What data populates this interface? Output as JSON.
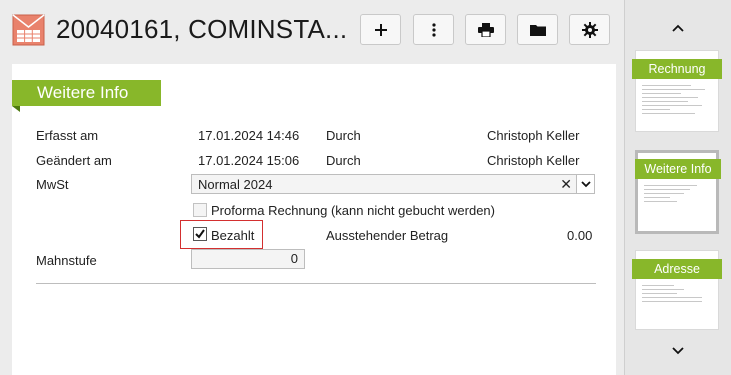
{
  "header": {
    "title": "20040161, COMINSTA...",
    "app_icon": "mail-calendar-icon",
    "buttons": [
      {
        "name": "add-button",
        "icon": "plus-icon"
      },
      {
        "name": "more-button",
        "icon": "vertical-dots-icon"
      },
      {
        "name": "print-button",
        "icon": "printer-icon"
      },
      {
        "name": "folder-button",
        "icon": "folder-icon"
      },
      {
        "name": "settings-button",
        "icon": "gear-icon"
      }
    ]
  },
  "section": {
    "title": "Weitere Info"
  },
  "form": {
    "erfasst_label": "Erfasst am",
    "erfasst_date": "17.01.2024 14:46",
    "erfasst_durch_label": "Durch",
    "erfasst_durch_value": "Christoph Keller",
    "geaendert_label": "Geändert am",
    "geaendert_date": "17.01.2024 15:06",
    "geaendert_durch_label": "Durch",
    "geaendert_durch_value": "Christoph Keller",
    "mwst_label": "MwSt",
    "mwst_value": "Normal 2024",
    "mwst_clear": "✕",
    "proforma_label": "Proforma Rechnung (kann nicht gebucht werden)",
    "proforma_checked": false,
    "bezahlt_label": "Bezahlt",
    "bezahlt_checked": true,
    "ausstehend_label": "Ausstehender Betrag",
    "ausstehend_value": "0.00",
    "mahnstufe_label": "Mahnstufe",
    "mahnstufe_value": "0"
  },
  "sidebar": {
    "up_icon": "chevron-up-icon",
    "down_icon": "chevron-down-icon",
    "pages": [
      {
        "label": "Rechnung",
        "selected": false
      },
      {
        "label": "Weitere Info",
        "selected": true
      },
      {
        "label": "Adresse",
        "selected": false
      }
    ]
  },
  "colors": {
    "accent_green": "#88b72a",
    "highlight_red": "#d32f2f",
    "panel_bg": "#ececec"
  }
}
